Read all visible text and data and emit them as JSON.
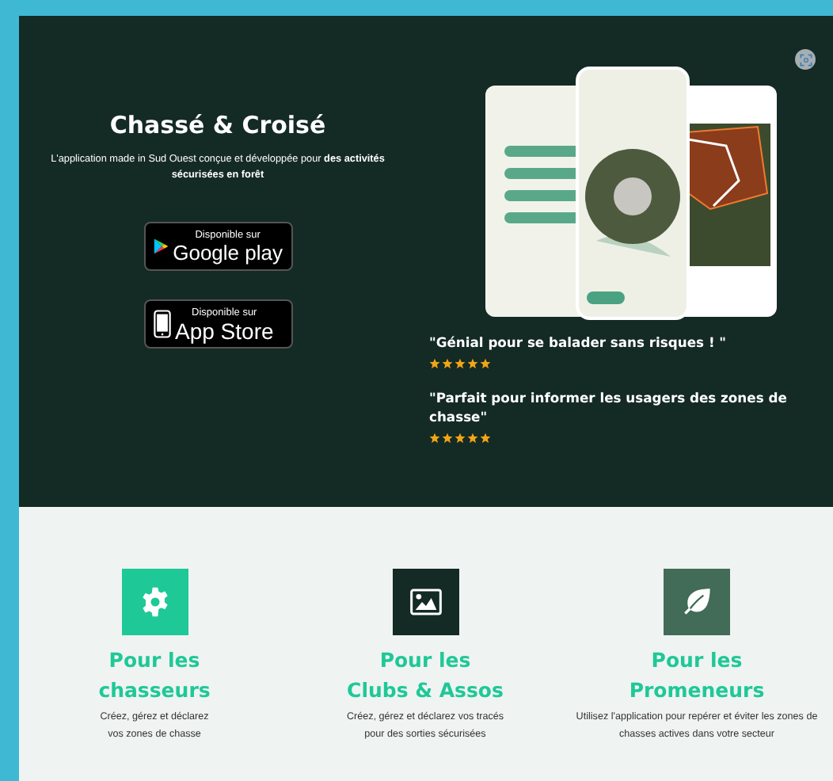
{
  "hero": {
    "title": "Chassé & Croisé",
    "description": "L'application made in Sud Ouest conçue et développée pour **des activités sécurisées en forêt**",
    "store_badges": [
      {
        "kind": "google",
        "small": "Disponible sur",
        "big": "Google play"
      },
      {
        "kind": "apple",
        "small": "Disponible sur",
        "big": "App Store"
      }
    ],
    "reviews": [
      {
        "quote": "\"Génial pour se balader sans risques ! \"",
        "stars": 5
      },
      {
        "quote": "\"Parfait pour informer les usagers des zones de chasse\"",
        "stars": 5
      }
    ]
  },
  "features": [
    {
      "title_1": "Pour les",
      "title_2": "chasseurs",
      "text": "Créez, gérez et déclarez vos zones de chasse",
      "color": "#1fc897"
    },
    {
      "title_1": "Pour les",
      "title_2": "Clubs & Assos",
      "text": "Créez, gérez et déclarez vos tracés pour des sorties sécurisées",
      "color": "#142a25"
    },
    {
      "title_1": "Pour les",
      "title_2": "Promeneurs",
      "text": "Utilisez l'application pour repérer et éviter les zones de chasses actives dans votre secteur",
      "color": "#426b58"
    }
  ]
}
